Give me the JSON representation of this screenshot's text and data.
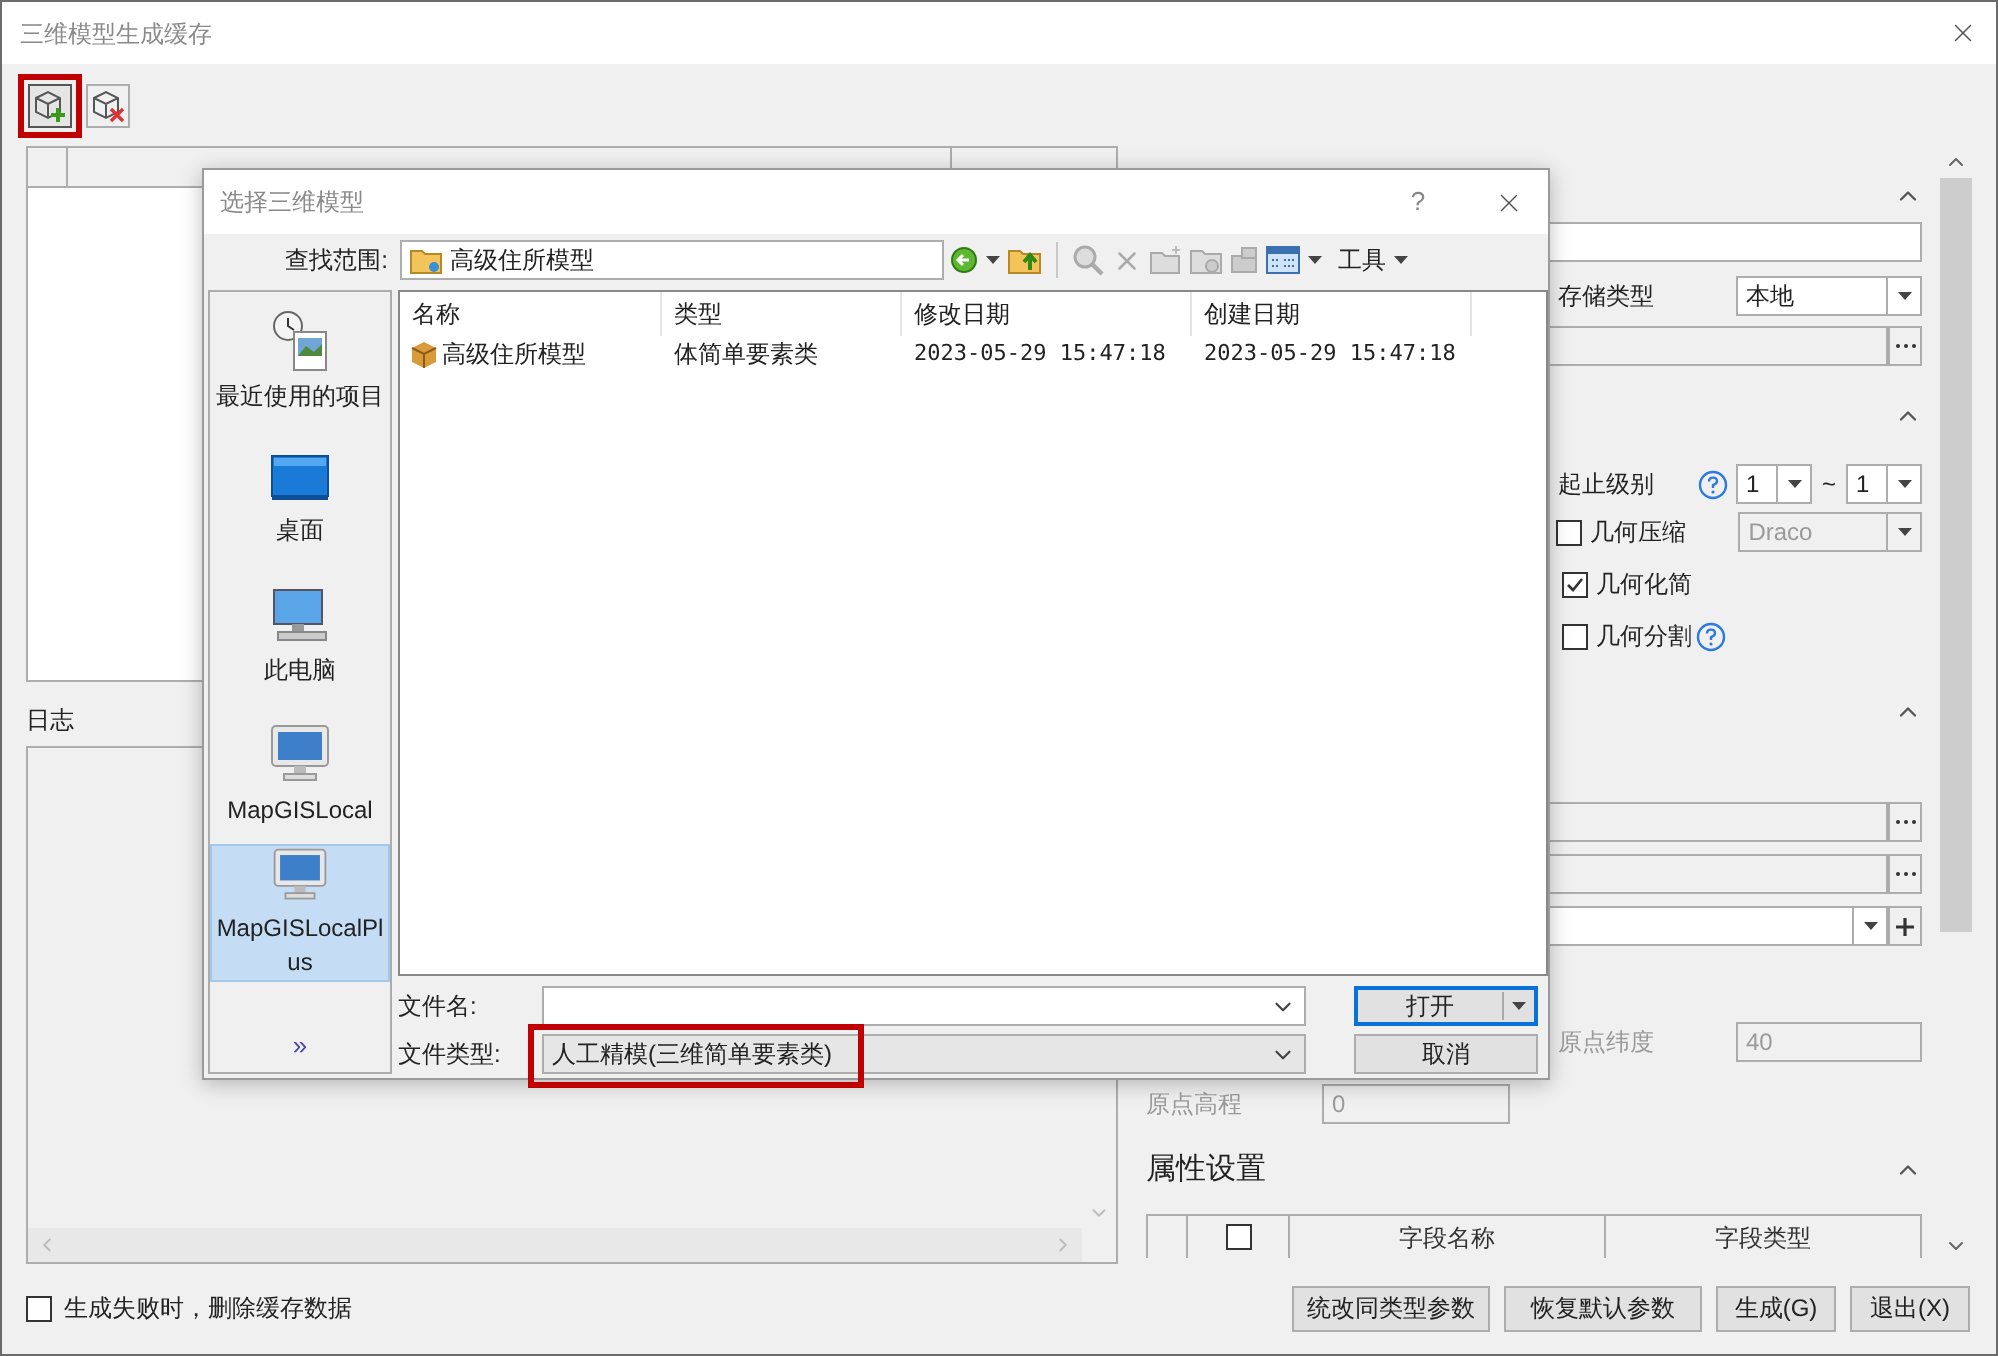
{
  "window": {
    "title": "三维模型生成缓存"
  },
  "toolbar": [
    {
      "kind": "add",
      "highlighted": true
    },
    {
      "kind": "remove",
      "highlighted": false
    }
  ],
  "log": {
    "label": "日志"
  },
  "right_panel": {
    "storage": {
      "expanded": true,
      "type_label": "存储类型",
      "type_value": "本地"
    },
    "generation": {
      "expanded": true,
      "level_label": "起止级别",
      "level_from": "1",
      "level_separator": "~",
      "level_to": "1",
      "compression": "Draco",
      "options": [
        {
          "kind": "dropdown",
          "label": "几何压缩",
          "checked": false
        },
        {
          "kind": "plain",
          "label": "几何化简",
          "checked": true
        },
        {
          "kind": "help",
          "label": "几何分割",
          "checked": false
        }
      ]
    },
    "origin": {
      "expanded": true,
      "latitude_label": "原点纬度",
      "latitude": "40",
      "elevation_label": "原点高程",
      "elevation": "0"
    },
    "attributes": {
      "title": "属性设置",
      "expanded": true,
      "all_checked": false,
      "columns": [
        "字段名称",
        "字段类型"
      ]
    }
  },
  "delete_on_fail": {
    "label": "生成失败时，删除缓存数据",
    "checked": false
  },
  "buttons": [
    "统改同类型参数",
    "恢复默认参数",
    "生成(G)",
    "退出(X)"
  ],
  "dialog": {
    "title": "选择三维模型",
    "help": "?",
    "look_in_label": "查找范围:",
    "location": "高级住所模型",
    "tools": "工具",
    "places": [
      {
        "kind": "recent",
        "label": "最近使用的项目",
        "selected": false
      },
      {
        "kind": "desktop",
        "label": "桌面",
        "selected": false
      },
      {
        "kind": "computer",
        "label": "此电脑",
        "selected": false
      },
      {
        "kind": "monitor",
        "label": "MapGISLocal",
        "selected": false
      },
      {
        "kind": "monitor",
        "label": "MapGISLocalPlus",
        "selected": true
      }
    ],
    "more": "»",
    "columns": [
      "名称",
      "类型",
      "修改日期",
      "创建日期"
    ],
    "rows": [
      {
        "name": "高级住所模型",
        "type": "体简单要素类",
        "modified": "2023-05-29 15:47:18",
        "created": "2023-05-29 15:47:18"
      }
    ],
    "file_name_label": "文件名:",
    "file_type_label": "文件类型:",
    "file_type": "人工精模(三维简单要素类)",
    "file_type_highlighted": true,
    "open": "打开",
    "cancel": "取消"
  }
}
